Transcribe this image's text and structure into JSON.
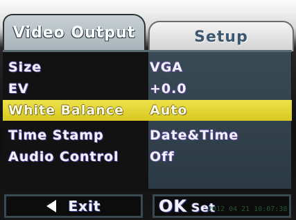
{
  "tabs": {
    "video_output": "Video Output",
    "setup": "Setup"
  },
  "menu": [
    {
      "label": "Size",
      "value": "VGA",
      "selected": false
    },
    {
      "label": "EV",
      "value": "+0.0",
      "selected": false
    },
    {
      "label": "White Balance",
      "value": "Auto",
      "selected": true
    },
    {
      "label": "Time Stamp",
      "value": "Date&Time",
      "selected": false
    },
    {
      "label": "Audio Control",
      "value": "Off",
      "selected": false
    }
  ],
  "footer": {
    "exit_label": "Exit",
    "ok_label": "OK",
    "set_label": "Set"
  },
  "overlay_timestamp": "2012 04 21 10:07:38",
  "colors": {
    "selected_bg": "#e6d63a",
    "panel_right": "#34434d",
    "text": "#f3f0ff"
  }
}
